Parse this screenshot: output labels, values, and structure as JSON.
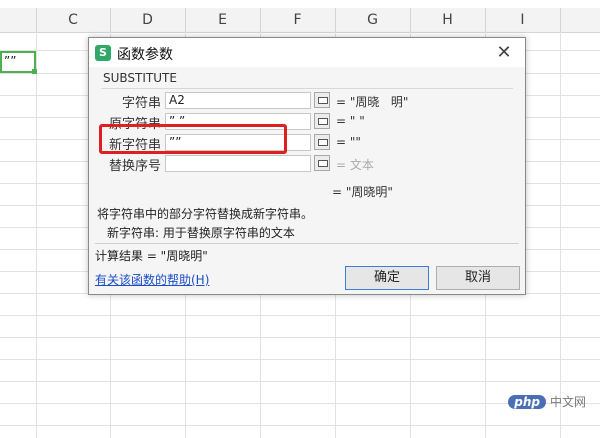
{
  "spreadsheet": {
    "columns": [
      "C",
      "D",
      "E",
      "F",
      "G",
      "H",
      "I"
    ],
    "selected_cell_value": "””"
  },
  "dialog": {
    "title": "函数参数",
    "app_icon_letter": "S",
    "function_name": "SUBSTITUTE",
    "params": [
      {
        "label": "字符串",
        "value": "A2",
        "result": "= \"周晓   明\""
      },
      {
        "label": "原字符串",
        "value": "” ”",
        "result": "= \" \""
      },
      {
        "label": "新字符串",
        "value": "””",
        "result": "= \"\""
      },
      {
        "label": "替换序号",
        "value": "",
        "result": "= 文本"
      }
    ],
    "overall_result": "= \"周晓明\"",
    "description": "将字符串中的部分字符替换成新字符串。",
    "param_help": "新字符串: 用于替换原字符串的文本",
    "calc_result": "计算结果 = \"周晓明\"",
    "help_link": "有关该函数的帮助(H)",
    "ok_label": "确定",
    "cancel_label": "取消"
  },
  "watermark": {
    "logo": "php",
    "text": "中文网"
  },
  "colors": {
    "highlight": "#e02020",
    "selection": "#4caf50",
    "link": "#1a4dc7",
    "ok_border": "#3c7fd8"
  }
}
